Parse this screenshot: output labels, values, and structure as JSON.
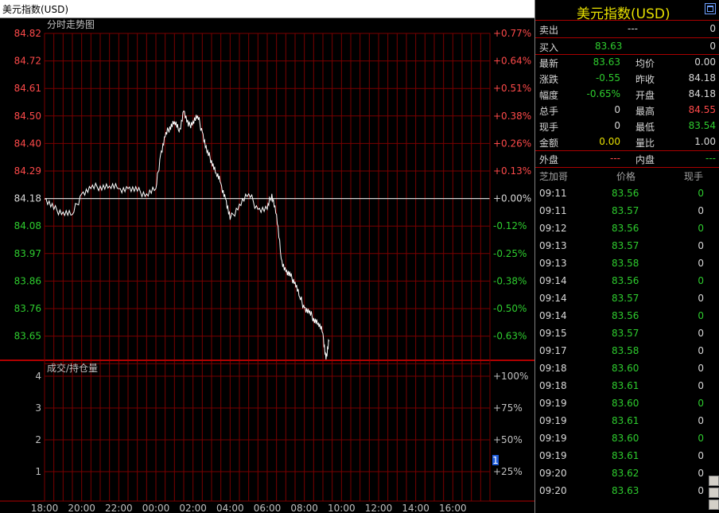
{
  "title": "美元指数(USD)",
  "panel_title": "美元指数(USD)",
  "upper_label": "分时走势图",
  "lower_label": "成交/持仓量",
  "colors": {
    "up": "#ff4a4a",
    "down": "#2ecc2e",
    "neutral": "#d8d8d8",
    "grid": "#7a0000",
    "accent": "#e8e000"
  },
  "price_axis": [
    {
      "label": "84.82",
      "pct": "+0.77%",
      "dir": "up"
    },
    {
      "label": "84.72",
      "pct": "+0.64%",
      "dir": "up"
    },
    {
      "label": "84.61",
      "pct": "+0.51%",
      "dir": "up"
    },
    {
      "label": "84.50",
      "pct": "+0.38%",
      "dir": "up"
    },
    {
      "label": "84.40",
      "pct": "+0.26%",
      "dir": "up"
    },
    {
      "label": "84.29",
      "pct": "+0.13%",
      "dir": "up"
    },
    {
      "label": "84.18",
      "pct": "+0.00%",
      "dir": "flat"
    },
    {
      "label": "84.08",
      "pct": "-0.12%",
      "dir": "down"
    },
    {
      "label": "83.97",
      "pct": "-0.25%",
      "dir": "down"
    },
    {
      "label": "83.86",
      "pct": "-0.38%",
      "dir": "down"
    },
    {
      "label": "83.76",
      "pct": "-0.50%",
      "dir": "down"
    },
    {
      "label": "83.65",
      "pct": "-0.63%",
      "dir": "down"
    }
  ],
  "volume_axis": [
    {
      "label": "4",
      "pct": "+100%"
    },
    {
      "label": "3",
      "pct": "+75%"
    },
    {
      "label": "2",
      "pct": "+50%"
    },
    {
      "label": "1",
      "pct": "+25%"
    }
  ],
  "volume_marker": "1",
  "time_axis": [
    "18:00",
    "20:00",
    "22:00",
    "00:00",
    "02:00",
    "04:00",
    "06:00",
    "08:00",
    "10:00",
    "12:00",
    "14:00",
    "16:00"
  ],
  "chart_data": {
    "type": "line",
    "title": "分时走势图",
    "ylim": [
      83.55,
      84.82
    ],
    "reference": 84.18,
    "x": [
      "18:00",
      "18:30",
      "19:00",
      "19:30",
      "20:00",
      "20:30",
      "21:00",
      "21:30",
      "22:00",
      "22:30",
      "23:00",
      "23:30",
      "00:00",
      "00:15",
      "00:30",
      "00:45",
      "01:00",
      "01:15",
      "01:30",
      "01:45",
      "02:00",
      "02:15",
      "02:30",
      "02:45",
      "03:00",
      "03:15",
      "03:30",
      "03:45",
      "04:00",
      "04:30",
      "05:00",
      "05:30",
      "06:00",
      "06:15",
      "06:30",
      "06:45",
      "07:00",
      "07:15",
      "07:30",
      "07:45",
      "08:00",
      "08:15",
      "08:30",
      "08:45",
      "09:00",
      "09:10",
      "09:20"
    ],
    "values": [
      84.18,
      84.14,
      84.13,
      84.12,
      84.2,
      84.22,
      84.23,
      84.23,
      84.22,
      84.22,
      84.21,
      84.2,
      84.22,
      84.35,
      84.42,
      84.46,
      84.48,
      84.44,
      84.52,
      84.46,
      84.48,
      84.5,
      84.44,
      84.36,
      84.33,
      84.28,
      84.24,
      84.18,
      84.1,
      84.16,
      84.2,
      84.14,
      84.14,
      84.2,
      84.12,
      83.95,
      83.9,
      83.88,
      83.86,
      83.8,
      83.76,
      83.74,
      83.72,
      83.7,
      83.66,
      83.56,
      83.63
    ]
  },
  "quote": {
    "sell": {
      "label": "卖出",
      "price": "---",
      "qty": "0"
    },
    "buy": {
      "label": "买入",
      "price": "83.63",
      "qty": "0"
    },
    "latest": {
      "label": "最新",
      "value": "83.63",
      "label2": "均价",
      "value2": "0.00"
    },
    "change": {
      "label": "涨跌",
      "value": "-0.55",
      "label2": "昨收",
      "value2": "84.18"
    },
    "range": {
      "label": "幅度",
      "value": "-0.65%",
      "label2": "开盘",
      "value2": "84.18"
    },
    "total": {
      "label": "总手",
      "value": "0",
      "label2": "最高",
      "value2": "84.55"
    },
    "current": {
      "label": "现手",
      "value": "0",
      "label2": "最低",
      "value2": "83.54"
    },
    "amount": {
      "label": "金额",
      "value": "0.00",
      "label2": "量比",
      "value2": "1.00"
    },
    "outer": {
      "label": "外盘",
      "value": "---",
      "label2": "内盘",
      "value2": "---"
    }
  },
  "ticks_header": {
    "exchange": "芝加哥",
    "price": "价格",
    "qty": "现手"
  },
  "ticks": [
    {
      "time": "09:11",
      "price": "83.56",
      "qty": "0",
      "dir": "down"
    },
    {
      "time": "09:11",
      "price": "83.57",
      "qty": "0",
      "dir": "flat"
    },
    {
      "time": "09:12",
      "price": "83.56",
      "qty": "0",
      "dir": "down"
    },
    {
      "time": "09:13",
      "price": "83.57",
      "qty": "0",
      "dir": "flat"
    },
    {
      "time": "09:13",
      "price": "83.58",
      "qty": "0",
      "dir": "flat"
    },
    {
      "time": "09:14",
      "price": "83.56",
      "qty": "0",
      "dir": "down"
    },
    {
      "time": "09:14",
      "price": "83.57",
      "qty": "0",
      "dir": "flat"
    },
    {
      "time": "09:14",
      "price": "83.56",
      "qty": "0",
      "dir": "down"
    },
    {
      "time": "09:15",
      "price": "83.57",
      "qty": "0",
      "dir": "flat"
    },
    {
      "time": "09:17",
      "price": "83.58",
      "qty": "0",
      "dir": "flat"
    },
    {
      "time": "09:18",
      "price": "83.60",
      "qty": "0",
      "dir": "flat"
    },
    {
      "time": "09:18",
      "price": "83.61",
      "qty": "0",
      "dir": "flat"
    },
    {
      "time": "09:19",
      "price": "83.60",
      "qty": "0",
      "dir": "down"
    },
    {
      "time": "09:19",
      "price": "83.61",
      "qty": "0",
      "dir": "flat"
    },
    {
      "time": "09:19",
      "price": "83.60",
      "qty": "0",
      "dir": "down"
    },
    {
      "time": "09:19",
      "price": "83.61",
      "qty": "0",
      "dir": "flat"
    },
    {
      "time": "09:20",
      "price": "83.62",
      "qty": "0",
      "dir": "flat"
    },
    {
      "time": "09:20",
      "price": "83.63",
      "qty": "0",
      "dir": "flat"
    }
  ]
}
